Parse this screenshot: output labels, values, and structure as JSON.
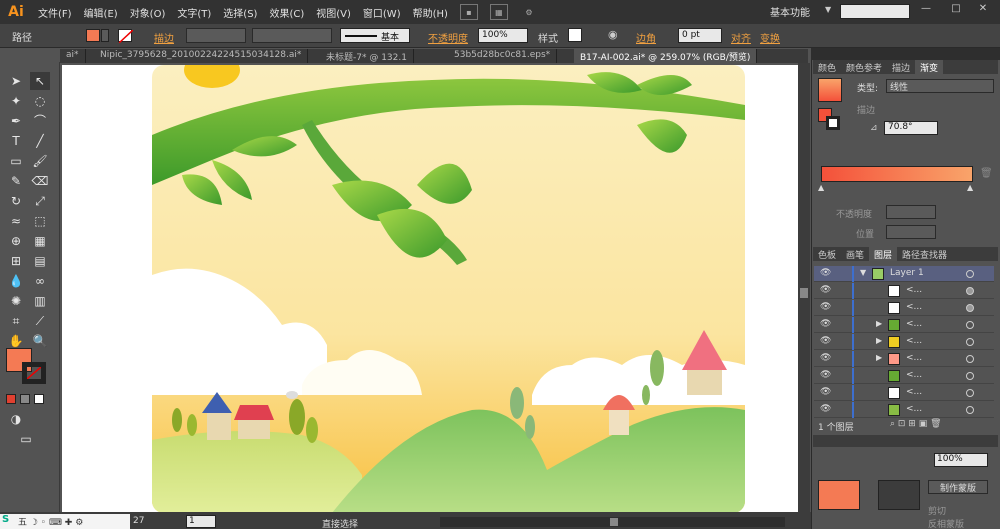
{
  "app": {
    "logo": "Ai",
    "menus": [
      "文件(F)",
      "编辑(E)",
      "对象(O)",
      "文字(T)",
      "选择(S)",
      "效果(C)",
      "视图(V)",
      "窗口(W)",
      "帮助(H)"
    ],
    "workspace": "基本功能",
    "workspace_arrow": "▼",
    "win_min": "—",
    "win_max": "□",
    "win_close": "✕"
  },
  "control": {
    "selection_label": "路径",
    "stroke_label": "描边",
    "stroke_style": "基本",
    "opacity_label": "不透明度",
    "opacity_value": "100%",
    "style_label": "样式",
    "corner_label": "边角",
    "corner_value": "0 pt",
    "align_label": "对齐",
    "transform_label": "变换"
  },
  "tabs": [
    {
      "label": "ai*"
    },
    {
      "label": "Nipic_3795628_20100224224515034128.ai*"
    },
    {
      "label": "未标题-7* @ 132.1"
    },
    {
      "label": "53b5d28bc0c81.eps*"
    },
    {
      "label": "B17-AI-002.ai* @ 259.07% (RGB/预览)"
    }
  ],
  "gradient_panel": {
    "tabs": [
      "颜色",
      "颜色参考",
      "描边",
      "渐变"
    ],
    "type_label": "类型:",
    "type_value": "线性",
    "stroke_label": "描边",
    "angle_value": "70.8°",
    "opacity_label": "不透明度",
    "position_label": "位置",
    "gradient_start": "#f4513a",
    "gradient_end": "#f9a46a"
  },
  "layers_panel": {
    "tabs": [
      "色板",
      "画笔",
      "图层",
      "路径查找器"
    ],
    "layer_name": "Layer 1",
    "sublayer_label": "<...",
    "count_text": "1 个图层"
  },
  "transparency_panel": {
    "opacity_value": "100%",
    "make_mask": "制作蒙版",
    "clip": "剪切",
    "invert_mask": "反相蒙版"
  },
  "status": {
    "zoom": "27",
    "page": "1",
    "tool_text": "直接选择"
  },
  "colors": {
    "fill": "#f47a54",
    "accent_orange": "#f0a040"
  }
}
